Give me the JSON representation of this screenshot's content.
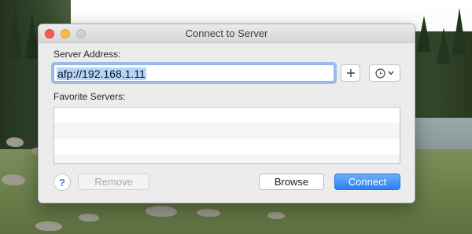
{
  "window": {
    "title": "Connect to Server"
  },
  "server_address": {
    "label": "Server Address:",
    "value": "afp://192.168.1.11"
  },
  "favorites": {
    "label": "Favorite Servers:",
    "items": []
  },
  "buttons": {
    "help_label": "?",
    "remove_label": "Remove",
    "browse_label": "Browse",
    "connect_label": "Connect"
  },
  "icons": {
    "add_favorite": "plus-icon",
    "recent_servers": "clock-icon",
    "dropdown": "chevron-down-icon"
  },
  "colors": {
    "accent": "#2f7ff4",
    "close": "#fc5753",
    "minimize": "#fdbc40"
  }
}
